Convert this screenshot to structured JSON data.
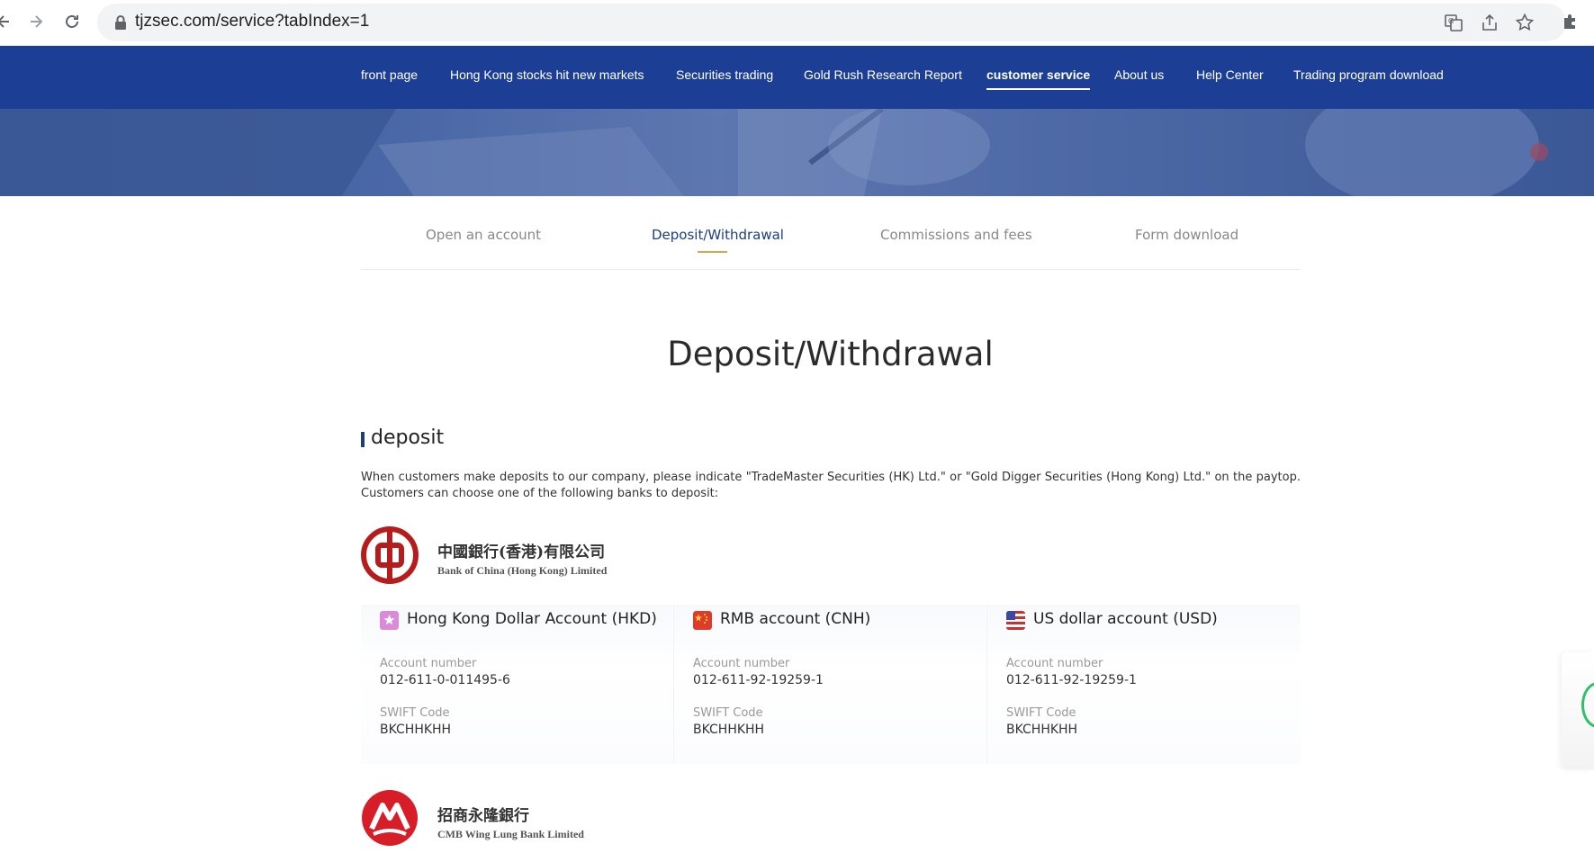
{
  "browser": {
    "url": "tjzsec.com/service?tabIndex=1"
  },
  "nav": {
    "items": [
      {
        "label": "front page"
      },
      {
        "label": "Hong Kong stocks hit new markets"
      },
      {
        "label": "Securities trading"
      },
      {
        "label": "Gold Rush Research Report"
      },
      {
        "label": "customer service",
        "active": true
      },
      {
        "label": "About us"
      },
      {
        "label": "Help Center"
      },
      {
        "label": "Trading program download"
      }
    ]
  },
  "tabs": [
    {
      "label": "Open an account"
    },
    {
      "label": "Deposit/Withdrawal",
      "active": true
    },
    {
      "label": "Commissions and fees"
    },
    {
      "label": "Form download"
    }
  ],
  "page": {
    "title": "Deposit/Withdrawal",
    "section_title": "deposit",
    "intro": "When customers make deposits to our company, please indicate \"TradeMaster Securities (HK) Ltd.\" or \"Gold Digger Securities (Hong Kong) Ltd.\" on the paytop. Customers can choose one of the following banks to deposit:"
  },
  "banks": [
    {
      "name_cn": "中國銀行(香港)有限公司",
      "name_en": "Bank of China (Hong Kong) Limited",
      "brand_color": "#b71c1c",
      "accounts": [
        {
          "flag_icon": "hong-kong-flag-icon",
          "title": "Hong Kong Dollar Account (HKD)",
          "account_label": "Account number",
          "account_number": "012-611-0-011495-6",
          "swift_label": "SWIFT Code",
          "swift_code": "BKCHHKHH"
        },
        {
          "flag_icon": "china-flag-icon",
          "title": "RMB account (CNH)",
          "account_label": "Account number",
          "account_number": "012-611-92-19259-1",
          "swift_label": "SWIFT Code",
          "swift_code": "BKCHHKHH"
        },
        {
          "flag_icon": "usa-flag-icon",
          "title": "US dollar account (USD)",
          "account_label": "Account number",
          "account_number": "012-611-92-19259-1",
          "swift_label": "SWIFT Code",
          "swift_code": "BKCHHKHH"
        }
      ]
    },
    {
      "name_cn": "招商永隆銀行",
      "name_en": "CMB Wing Lung Bank Limited",
      "brand_color": "#d71e28"
    }
  ],
  "colors": {
    "nav_bg": "#1c3f95",
    "tab_active": "#1c3f7c",
    "tab_underline": "#d4a84b"
  }
}
